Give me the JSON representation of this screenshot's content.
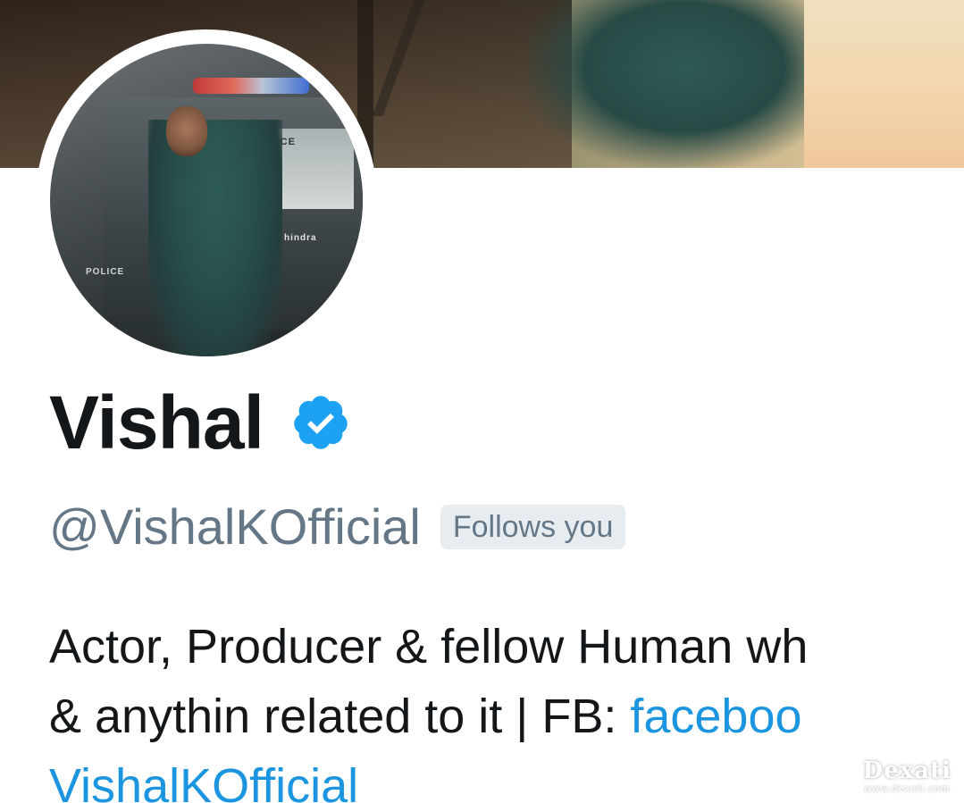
{
  "profile": {
    "display_name": "Vishal",
    "verified_icon": "verified-badge-icon",
    "handle": "@VishalKOfficial",
    "follows_you_label": "Follows you",
    "bio_line1": "Actor, Producer & fellow Human wh",
    "bio_line2_text": "& anythin related to it | FB: ",
    "bio_line2_link": "faceboo",
    "bio_line3_link": "VishalKOfficial"
  },
  "banner": {
    "alt": "header-photo"
  },
  "avatar_photo": {
    "police_label_top": "POLICE",
    "police_label_side": "POLICE",
    "brand_label": "hindra"
  },
  "watermark": {
    "main": "Dexati",
    "sub": "www.dexati.com"
  },
  "colors": {
    "name": "#14171a",
    "secondary_text": "#657786",
    "link": "#1b95e0",
    "verified_blue": "#1da1f2",
    "badge_bg": "#e6ecf0"
  }
}
